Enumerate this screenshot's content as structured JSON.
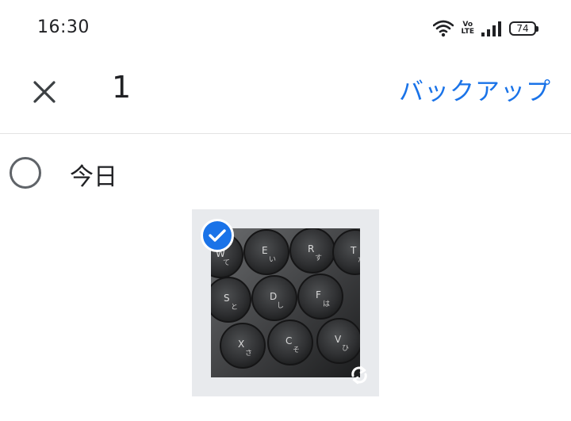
{
  "status_bar": {
    "time": "16:30",
    "volte_line1": "Vo",
    "volte_line2": "LTE",
    "battery": "74"
  },
  "app_bar": {
    "close_icon": "close-icon",
    "selected_count": "1",
    "backup_label": "バックアップ"
  },
  "section": {
    "title": "今日",
    "radio_icon": "radio-unchecked-icon"
  },
  "photo": {
    "selected": true,
    "check_icon": "checkmark-icon",
    "sync_icon": "sync-icon",
    "subject": "keyboard",
    "keys": [
      {
        "main": "W",
        "kana": "て"
      },
      {
        "main": "E",
        "kana": "い"
      },
      {
        "main": "R",
        "kana": "す"
      },
      {
        "main": "T",
        "kana": "か"
      },
      {
        "main": "S",
        "kana": "と"
      },
      {
        "main": "D",
        "kana": "し"
      },
      {
        "main": "F",
        "kana": "は"
      },
      {
        "main": "X",
        "kana": "さ"
      },
      {
        "main": "C",
        "kana": "そ"
      },
      {
        "main": "V",
        "kana": "ひ"
      }
    ]
  },
  "colors": {
    "accent": "#1a73e8",
    "text": "#202124",
    "icon_grey": "#5f6368",
    "tile_bg": "#e8eaed"
  }
}
